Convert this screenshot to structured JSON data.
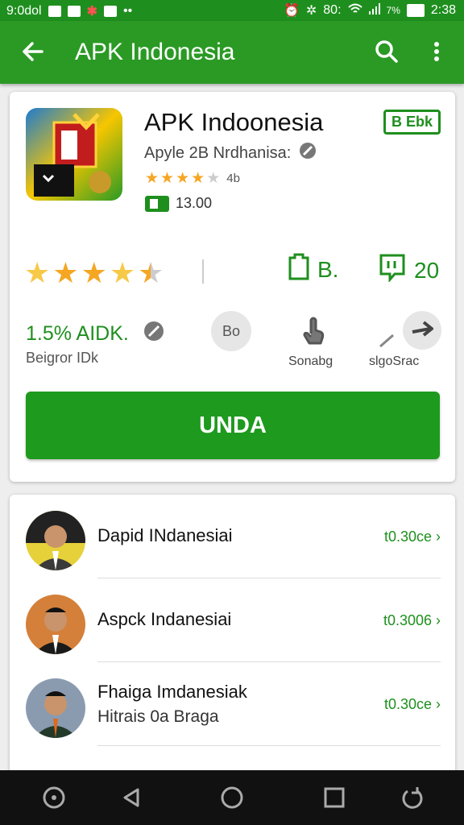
{
  "status": {
    "left_text": "9:0dol",
    "battery_text": "80:",
    "percent_text": "7%",
    "time": "2:38"
  },
  "appbar": {
    "title": "APK Indonesia",
    "back_icon": "arrow-left-icon",
    "search_icon": "search-icon",
    "more_icon": "more-vert-icon"
  },
  "app": {
    "name": "APK Indoonesia",
    "badge": "B Ebk",
    "developer": "Apyle 2B Nrdhanisa:",
    "small_rating_count": "4b",
    "small_stars": 4,
    "price": "13.00",
    "rating_stars": 4.5,
    "stat1_value": "B.",
    "stat2_value": "20",
    "downloads_value": "1.5% AIDK.",
    "downloads_label": "Beigror IDk",
    "action1_circle": "Bo",
    "action2_label": "Sonabg",
    "action3_label": "slgoSrac",
    "install_label": "UNDA"
  },
  "list": [
    {
      "name": "Dapid INdanesiai",
      "sub": "",
      "value": "t0.30ce ›"
    },
    {
      "name": "Aspck Indanesiai",
      "sub": "",
      "value": "t0.3006 ›"
    },
    {
      "name": "Fhaiga Imdanesiak",
      "sub": "Hitrais 0a Braga",
      "value": "t0.30ce ›"
    }
  ],
  "colors": {
    "primary": "#2a9a24",
    "accent": "#1e8f1e",
    "star": "#f5a623"
  }
}
